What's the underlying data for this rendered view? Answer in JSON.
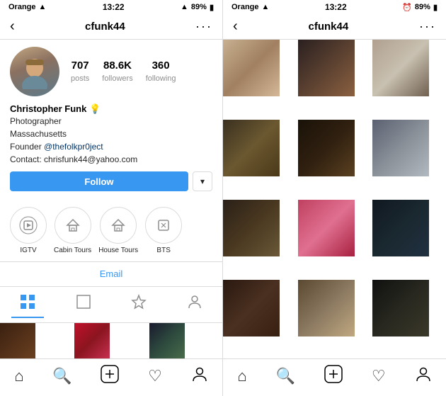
{
  "left_panel": {
    "status_bar": {
      "carrier": "Orange",
      "time": "13:22",
      "battery": "89%"
    },
    "nav": {
      "back_icon": "‹",
      "username": "cfunk44",
      "more_icon": "···"
    },
    "stats": {
      "posts": {
        "value": "707",
        "label": "posts"
      },
      "followers": {
        "value": "88.6K",
        "label": "followers"
      },
      "following": {
        "value": "360",
        "label": "following"
      }
    },
    "follow_button": "Follow",
    "dropdown_button": "▾",
    "bio": {
      "name": "Christopher Funk 💡",
      "line1": "Photographer",
      "line2": "Massachusetts",
      "line3": "Founder @thefolkpr0ject",
      "line4": "Contact: chrisfunk44@yahoo.com"
    },
    "highlights": [
      {
        "label": "IGTV",
        "icon": "📺"
      },
      {
        "label": "Cabin Tours",
        "icon": "⌂"
      },
      {
        "label": "House Tours",
        "icon": "⌂"
      },
      {
        "label": "BTS",
        "icon": "⊡"
      }
    ],
    "email_label": "Email",
    "tabs": [
      "grid",
      "square",
      "star",
      "person"
    ],
    "photos_bottom": [
      "dark_tunnel",
      "red_hearts",
      "dark_forest"
    ]
  },
  "right_panel": {
    "status_bar": {
      "carrier": "Orange",
      "time": "13:22",
      "battery": "89%"
    },
    "nav": {
      "back_icon": "‹",
      "username": "cfunk44",
      "more_icon": "···"
    },
    "grid_photos": [
      "rp1",
      "rp2",
      "rp3",
      "rp4",
      "rp5",
      "rp6",
      "rp7",
      "rp8",
      "rp9",
      "rp10",
      "rp11",
      "rp12"
    ]
  }
}
